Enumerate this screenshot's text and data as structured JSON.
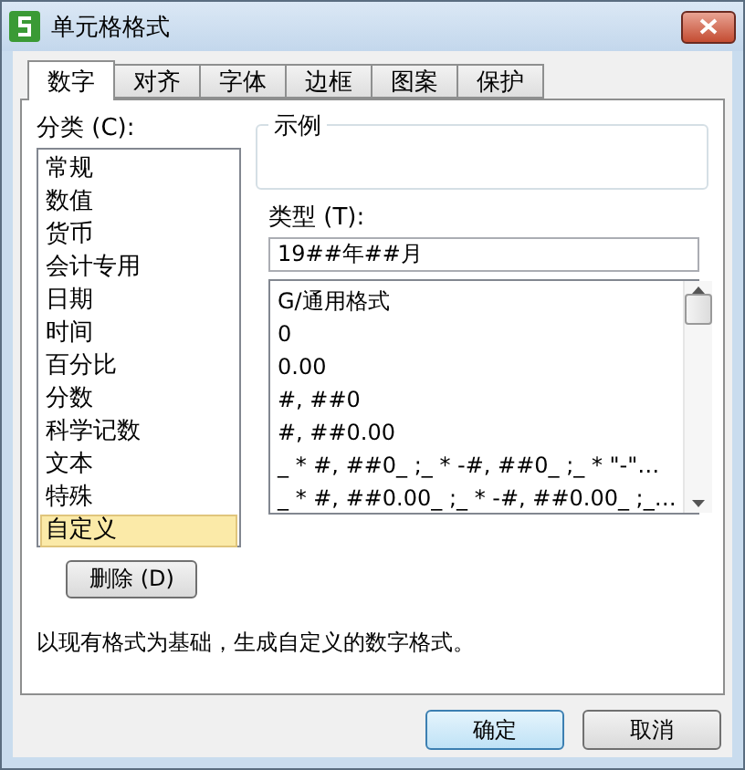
{
  "window": {
    "title": "单元格格式"
  },
  "tabs": [
    {
      "label": "数字",
      "selected": true
    },
    {
      "label": "对齐",
      "selected": false
    },
    {
      "label": "字体",
      "selected": false
    },
    {
      "label": "边框",
      "selected": false
    },
    {
      "label": "图案",
      "selected": false
    },
    {
      "label": "保护",
      "selected": false
    }
  ],
  "category": {
    "label": "分类 (C):",
    "items": [
      {
        "label": "常规",
        "selected": false
      },
      {
        "label": "数值",
        "selected": false
      },
      {
        "label": "货币",
        "selected": false
      },
      {
        "label": "会计专用",
        "selected": false
      },
      {
        "label": "日期",
        "selected": false
      },
      {
        "label": "时间",
        "selected": false
      },
      {
        "label": "百分比",
        "selected": false
      },
      {
        "label": "分数",
        "selected": false
      },
      {
        "label": "科学记数",
        "selected": false
      },
      {
        "label": "文本",
        "selected": false
      },
      {
        "label": "特殊",
        "selected": false
      },
      {
        "label": "自定义",
        "selected": true
      }
    ]
  },
  "sample": {
    "label": "示例"
  },
  "type": {
    "label": "类型 (T):",
    "value": "19##年##月",
    "formats": [
      "G/通用格式",
      "0",
      "0.00",
      "#, ##0",
      "#, ##0.00",
      "_ * #, ##0_ ;_ * -#, ##0_ ;_ * \"-\"…",
      "_ * #, ##0.00_ ;_ * -#, ##0.00_ ;_…"
    ]
  },
  "delete_button": "删除 (D)",
  "description": "以现有格式为基础，生成自定义的数字格式。",
  "buttons": [
    "确定",
    "取消"
  ]
}
